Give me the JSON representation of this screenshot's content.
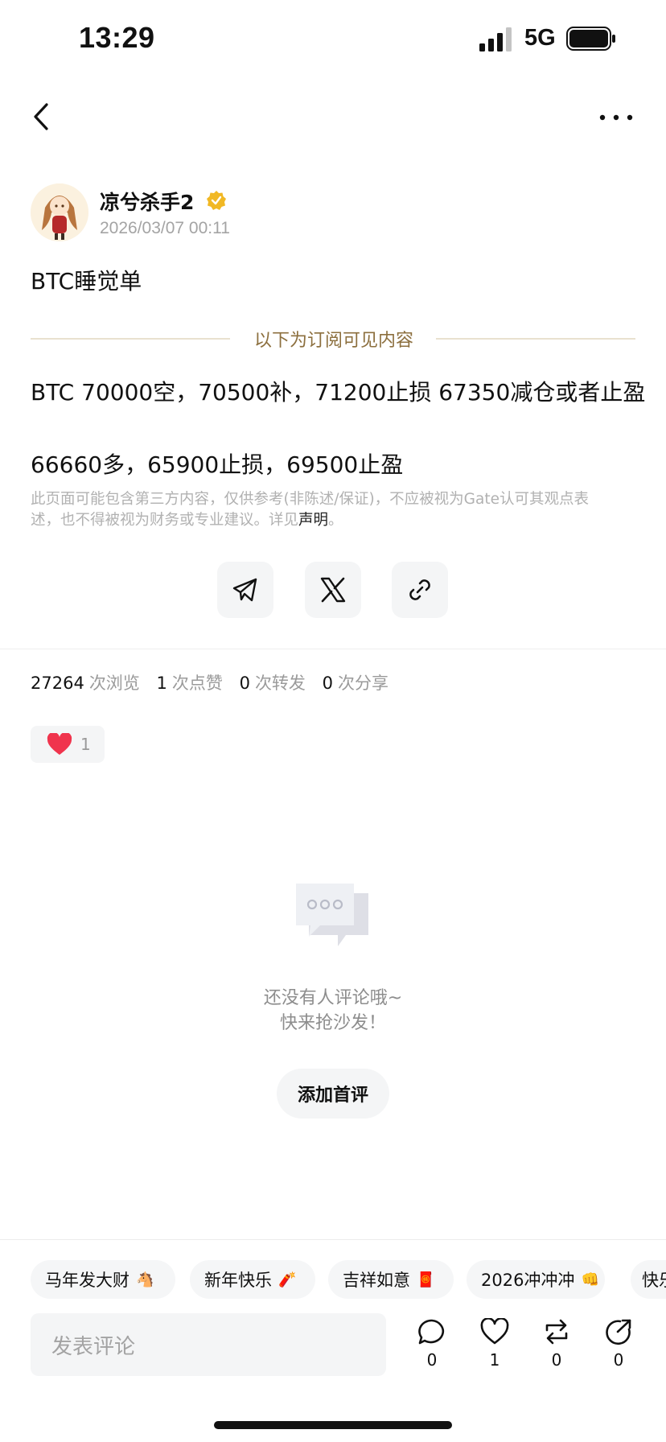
{
  "status_bar": {
    "time": "13:29",
    "network": "5G"
  },
  "author": {
    "name": "凉兮杀手2",
    "time": "2026/03/07 00:11"
  },
  "post": {
    "title": "BTC睡觉单",
    "subscriber_divider": "以下为订阅可见内容",
    "lines": [
      "BTC 70000空，70500补，71200止损 67350减仓或者止盈",
      "66660多，65900止损，69500止盈"
    ],
    "disclaimer_line1": "此页面可能包含第三方内容，仅供参考(非陈述/保证)，不应被视为Gate认可其观点表",
    "disclaimer_line2_prefix": "述，也不得被视为财务或专业建议。详见",
    "disclaimer_link": "声明",
    "disclaimer_suffix": "。"
  },
  "share_buttons": [
    "telegram-icon",
    "x-icon",
    "link-icon"
  ],
  "stats": {
    "views": "27264",
    "views_label": "次浏览",
    "likes": "1",
    "likes_label": "次点赞",
    "reposts": "0",
    "reposts_label": "次转发",
    "shares": "0",
    "shares_label": "次分享"
  },
  "reaction": {
    "icon": "heart-icon",
    "count": "1"
  },
  "empty_comments": {
    "line1": "还没有人评论哦~",
    "line2": "快来抢沙发！",
    "button": "添加首评"
  },
  "quick_replies": [
    {
      "label": "马年发大财",
      "emoji": "🐴"
    },
    {
      "label": "新年快乐",
      "emoji": "🧨"
    },
    {
      "label": "吉祥如意",
      "emoji": "🧧"
    },
    {
      "label": "2026冲冲冲",
      "emoji": "👊"
    },
    {
      "label": "快乐",
      "emoji": ""
    }
  ],
  "comment_bar": {
    "placeholder": "发表评论",
    "comment_count": "0",
    "like_count": "1",
    "repost_count": "0",
    "share_count": "0"
  },
  "colors": {
    "accent_gold": "#8c6f3e",
    "verified_badge": "#f1b824",
    "heart": "#f0344d"
  }
}
